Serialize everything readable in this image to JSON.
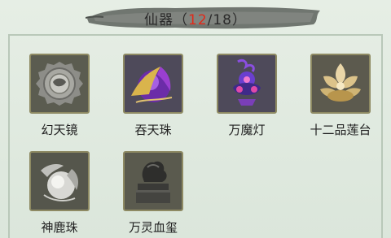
{
  "header": {
    "title": "仙器",
    "paren_open": "（",
    "owned": "12",
    "separator": "/18",
    "paren_close": "）"
  },
  "items": [
    {
      "name": "幻天镜",
      "icon": "silver-mirror-icon"
    },
    {
      "name": "吞天珠",
      "icon": "purple-pearl-icon"
    },
    {
      "name": "万魔灯",
      "icon": "demon-lamp-icon"
    },
    {
      "name": "十二品莲台",
      "icon": "lotus-platform-icon"
    },
    {
      "name": "神鹿珠",
      "icon": "deer-pearl-icon"
    },
    {
      "name": "万灵血玺",
      "icon": "blood-seal-icon"
    }
  ],
  "colors": {
    "background": "#dfe9df",
    "count_highlight": "#e02a1a",
    "slot_border": "#8e8a63"
  }
}
